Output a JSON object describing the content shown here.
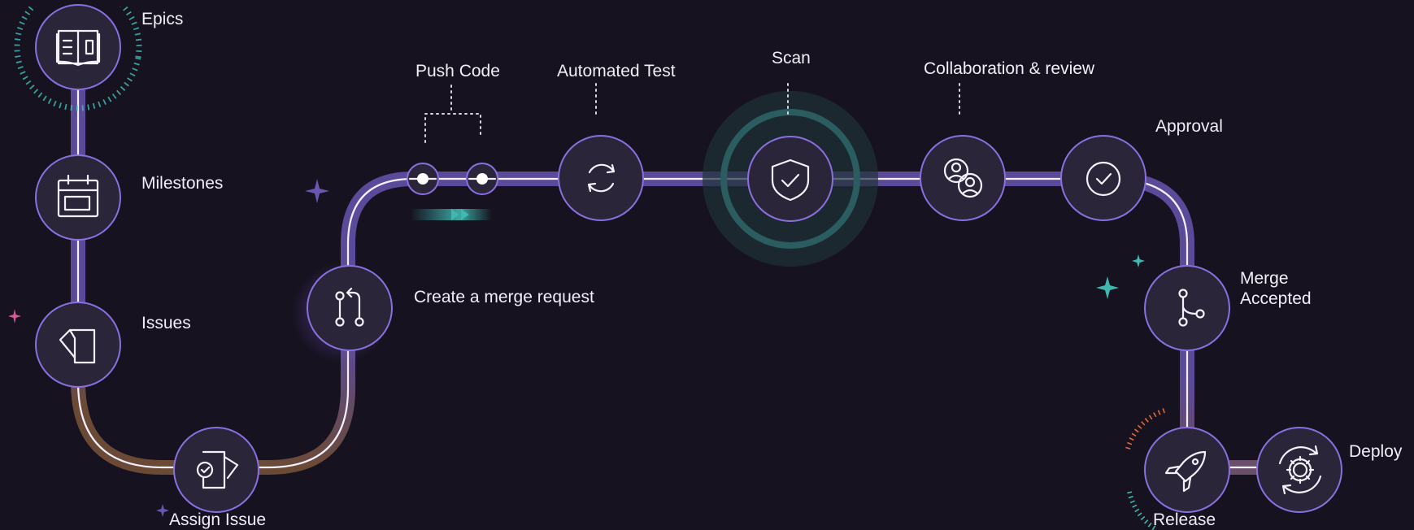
{
  "nodes": [
    {
      "key": "epics",
      "label": "Epics",
      "icon": "book-icon"
    },
    {
      "key": "milestones",
      "label": "Milestones",
      "icon": "calendar-icon"
    },
    {
      "key": "issues",
      "label": "Issues",
      "icon": "document-icon"
    },
    {
      "key": "assign",
      "label": "Assign Issue",
      "icon": "assign-check-icon"
    },
    {
      "key": "merge_request",
      "label": "Create a merge request",
      "icon": "merge-request-icon"
    },
    {
      "key": "push",
      "label": "Push Code",
      "icon": "commit-icon"
    },
    {
      "key": "test",
      "label": "Automated Test",
      "icon": "refresh-icon"
    },
    {
      "key": "scan",
      "label": "Scan",
      "icon": "shield-check-icon"
    },
    {
      "key": "collab",
      "label": "Collaboration & review",
      "icon": "users-icon"
    },
    {
      "key": "approval",
      "label": "Approval",
      "icon": "check-circle-icon"
    },
    {
      "key": "merge_accepted",
      "label": "Merge Accepted",
      "icon": "branch-icon"
    },
    {
      "key": "release",
      "label": "Release",
      "icon": "rocket-icon"
    },
    {
      "key": "deploy",
      "label": "Deploy",
      "icon": "gear-cycle-icon"
    }
  ],
  "labels": {
    "epics": "Epics",
    "milestones": "Milestones",
    "issues": "Issues",
    "assign": "Assign Issue",
    "merge_request": "Create a merge request",
    "push": "Push Code",
    "test": "Automated Test",
    "scan": "Scan",
    "collab": "Collaboration & review",
    "approval": "Approval",
    "merge_accepted": "Merge Accepted",
    "release": "Release",
    "deploy": "Deploy"
  },
  "colors": {
    "background": "#16121f",
    "node_fill": "#2a2538",
    "node_stroke": "#8a6fe0",
    "track_purple": "#5b4a9a",
    "track_brown": "#6b4a35",
    "accent_teal": "#3fb8b0",
    "accent_pink": "#d45a9a",
    "accent_orange": "#e06a3a"
  }
}
